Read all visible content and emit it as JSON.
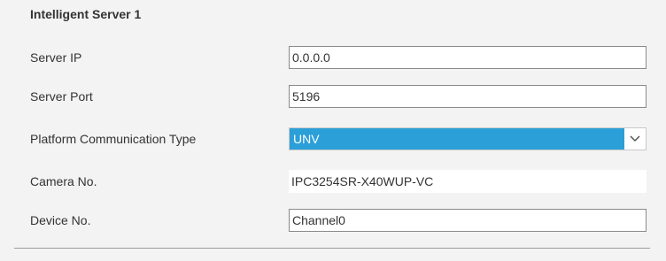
{
  "section": {
    "title": "Intelligent Server 1"
  },
  "fields": {
    "server_ip": {
      "label": "Server IP",
      "value": "0.0.0.0"
    },
    "server_port": {
      "label": "Server Port",
      "value": "5196"
    },
    "platform_type": {
      "label": "Platform Communication Type",
      "value": "UNV"
    },
    "camera_no": {
      "label": "Camera No.",
      "value": "IPC3254SR-X40WUP-VC"
    },
    "device_no": {
      "label": "Device No.",
      "value": "Channel0"
    }
  },
  "icons": {
    "dropdown": "chevron-down-icon"
  },
  "colors": {
    "background": "#f3f3f3",
    "select_highlight": "#2b9fd8",
    "text": "#333333"
  }
}
